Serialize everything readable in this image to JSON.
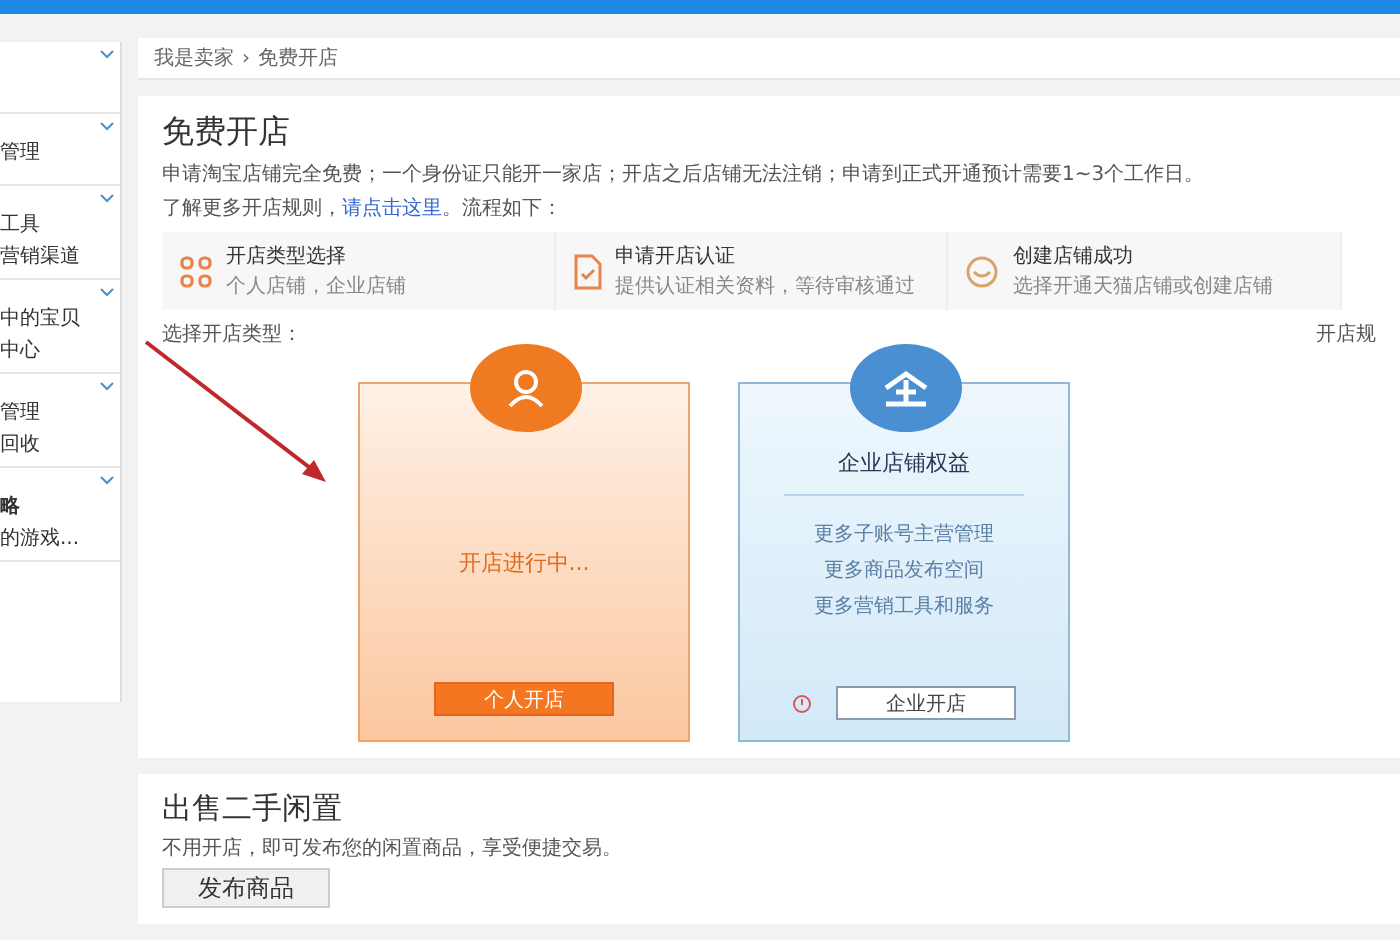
{
  "breadcrumb": {
    "items": [
      "我是卖家",
      "免费开店"
    ],
    "separator": "›"
  },
  "sidebar": {
    "groups": [
      {
        "expanded": true
      },
      {
        "items": [
          "管理"
        ],
        "expanded": true
      },
      {
        "items": [
          "工具",
          "营销渠道"
        ],
        "expanded": true
      },
      {
        "items": [
          "中的宝贝",
          "中心"
        ],
        "expanded": true
      },
      {
        "items": [
          "管理",
          "回收"
        ],
        "expanded": true
      },
      {
        "title": "略",
        "items": [
          "的游戏..."
        ],
        "expanded": true
      }
    ]
  },
  "open_shop": {
    "title": "免费开店",
    "notice": "申请淘宝店铺完全免费；一个身份证只能开一家店；开店之后店铺无法注销；申请到正式开通预计需要1~3个工作日。",
    "rules_prefix": "了解更多开店规则，",
    "rules_link": "请点击这里",
    "rules_suffix": "。流程如下：",
    "steps": [
      {
        "kind": "grid",
        "title": "开店类型选择",
        "desc": "个人店铺，企业店铺"
      },
      {
        "kind": "document",
        "title": "申请开店认证",
        "desc": "提供认证相关资料，等待审核通过"
      },
      {
        "kind": "smile",
        "title": "创建店铺成功",
        "desc": "选择开通天猫店铺或创建店铺"
      }
    ],
    "choose_label": "选择开店类型：",
    "side_link": "开店规",
    "cards": [
      {
        "kind": "personal",
        "status": "开店进行中...",
        "button": "个人开店"
      },
      {
        "kind": "enterprise",
        "title": "企业店铺权益",
        "benefits": [
          "更多子账号主营管理",
          "更多商品发布空间",
          "更多营销工具和服务"
        ],
        "button": "企业开店"
      }
    ]
  },
  "secondhand": {
    "title": "出售二手闲置",
    "desc": "不用开店，即可发布您的闲置商品，享受便捷交易。",
    "button": "发布商品"
  }
}
